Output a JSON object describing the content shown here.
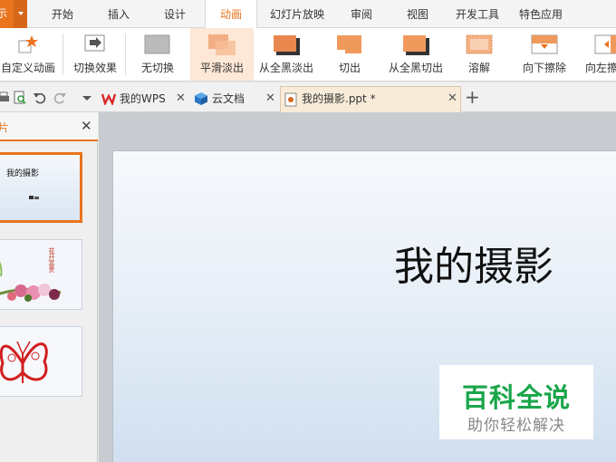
{
  "menu": {
    "app_label": "示",
    "tabs": [
      "开始",
      "插入",
      "设计",
      "动画",
      "幻灯片放映",
      "审阅",
      "视图",
      "开发工具",
      "特色应用"
    ],
    "active_tab": "动画"
  },
  "ribbon": {
    "custom_animation": "自定义动画",
    "transition_effect": "切换效果",
    "transitions": [
      "无切换",
      "平滑淡出",
      "从全黑淡出",
      "切出",
      "从全黑切出",
      "溶解",
      "向下擦除",
      "向左擦"
    ],
    "selected_transition": "平滑淡出"
  },
  "doctabs": {
    "tabs": [
      {
        "label": "我的WPS",
        "icon": "wps-logo-icon"
      },
      {
        "label": "云文档",
        "icon": "cloud-cube-icon"
      },
      {
        "label": "我的摄影.ppt *",
        "icon": "ppt-file-icon"
      }
    ],
    "active": "我的摄影.ppt *"
  },
  "leftpanel": {
    "title": "片",
    "thumb1_title": "我的摄影",
    "thumb2_caption": "花开富贵"
  },
  "slide": {
    "title": "我的摄影"
  },
  "watermark": {
    "title": "百科全说",
    "subtitle": "助你轻松解决"
  },
  "colors": {
    "accent": "#e8741e",
    "watermark_green": "#1aa64a"
  }
}
